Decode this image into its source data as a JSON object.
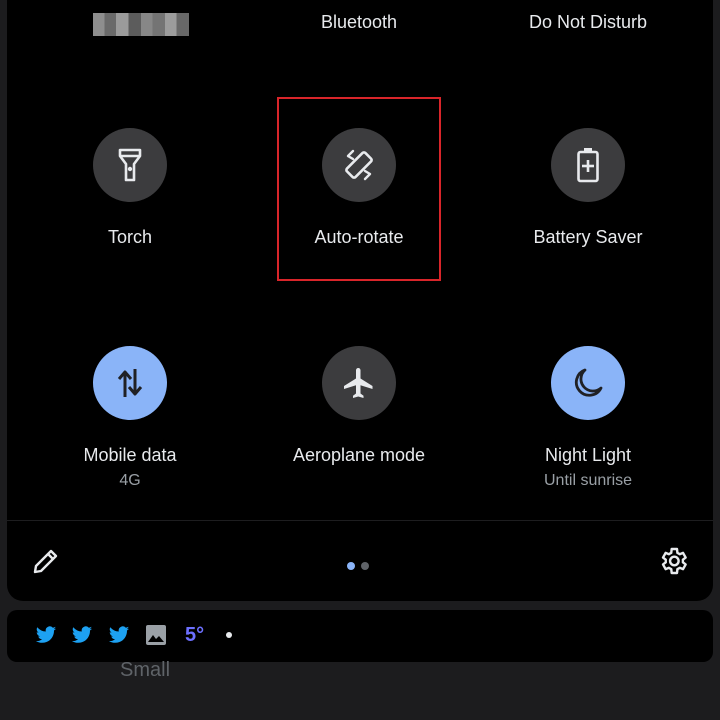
{
  "quick_settings": {
    "top_row": {
      "bluetooth": "Bluetooth",
      "dnd": "Do Not Disturb"
    },
    "tiles": {
      "torch": {
        "label": "Torch"
      },
      "auto_rotate": {
        "label": "Auto-rotate"
      },
      "battery_saver": {
        "label": "Battery Saver"
      },
      "mobile_data": {
        "label": "Mobile data",
        "sublabel": "4G"
      },
      "aeroplane": {
        "label": "Aeroplane mode"
      },
      "night_light": {
        "label": "Night Light",
        "sublabel": "Until sunrise"
      }
    },
    "footer": {
      "edit_icon": "pencil-icon",
      "settings_icon": "gear-icon",
      "page_dots": [
        {
          "active": true
        },
        {
          "active": false
        }
      ]
    }
  },
  "notification_bar": {
    "icons": [
      "twitter-icon",
      "twitter-icon",
      "twitter-icon",
      "image-icon"
    ],
    "temperature": "5°",
    "overflow_text": "Small"
  },
  "colors": {
    "panel_bg": "#000000",
    "tile_inactive": "#3c3c3e",
    "tile_active": "#8ab4f8",
    "highlight": "#d9252a",
    "twitter": "#1da1f2",
    "temperature": "#6d70ff"
  }
}
